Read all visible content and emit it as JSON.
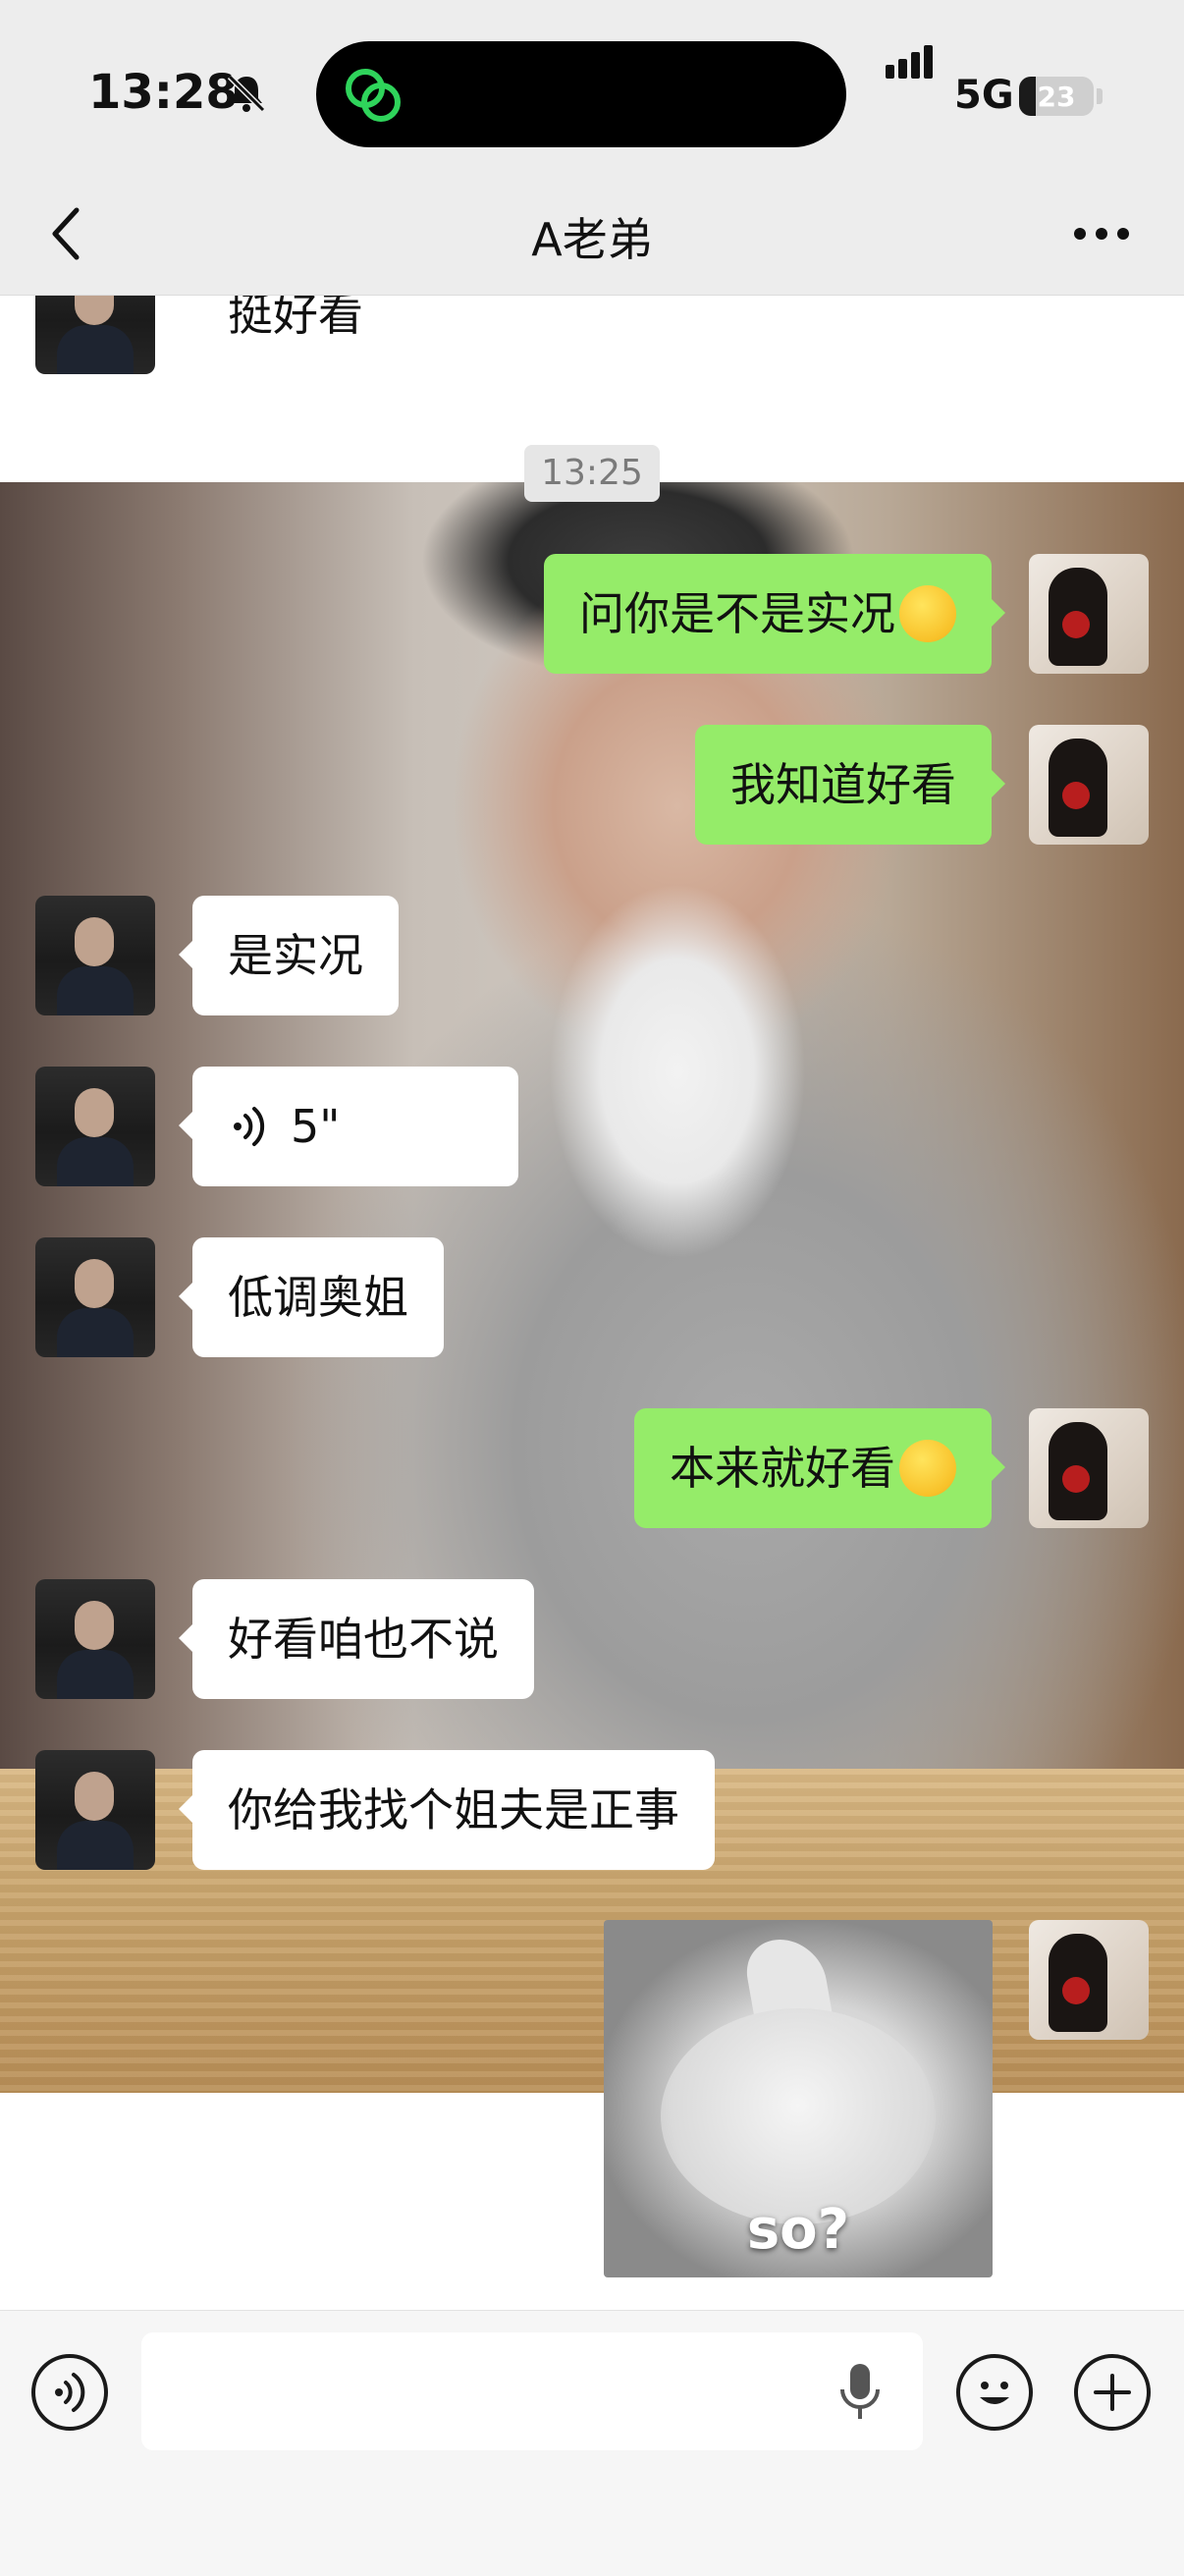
{
  "status_bar": {
    "time": "13:28",
    "network": "5G",
    "battery_level": "23",
    "battery_fraction": 0.23,
    "icons": [
      "bell-muted-icon",
      "wechat-audio-icon",
      "signal-icon",
      "battery-icon"
    ]
  },
  "header": {
    "title": "A老弟",
    "icons": [
      "back-chevron-icon",
      "more-dots-icon"
    ]
  },
  "chat": {
    "timestamp": "13:25",
    "messages": [
      {
        "side": "in",
        "type": "text",
        "text": "挺好看"
      },
      {
        "side": "out",
        "type": "text",
        "text": "问你是不是实况",
        "emoji": "laughing-tears-emoji"
      },
      {
        "side": "out",
        "type": "text",
        "text": "我知道好看"
      },
      {
        "side": "in",
        "type": "text",
        "text": "是实况"
      },
      {
        "side": "in",
        "type": "voice",
        "duration": "5\""
      },
      {
        "side": "in",
        "type": "text",
        "text": "低调奥姐"
      },
      {
        "side": "out",
        "type": "text",
        "text": "本来就好看",
        "emoji": "smirk-emoji"
      },
      {
        "side": "in",
        "type": "text",
        "text": "好看咱也不说"
      },
      {
        "side": "in",
        "type": "text",
        "text": "你给我找个姐夫是正事"
      },
      {
        "side": "out",
        "type": "sticker",
        "caption": "so?"
      }
    ]
  },
  "input_bar": {
    "text_value": "",
    "icons": [
      "voice-mode-icon",
      "microphone-icon",
      "emoji-icon",
      "plus-icon"
    ]
  },
  "colors": {
    "outgoing_bubble": "#95ec69",
    "incoming_bubble": "#ffffff",
    "header_bg": "#ededed"
  }
}
